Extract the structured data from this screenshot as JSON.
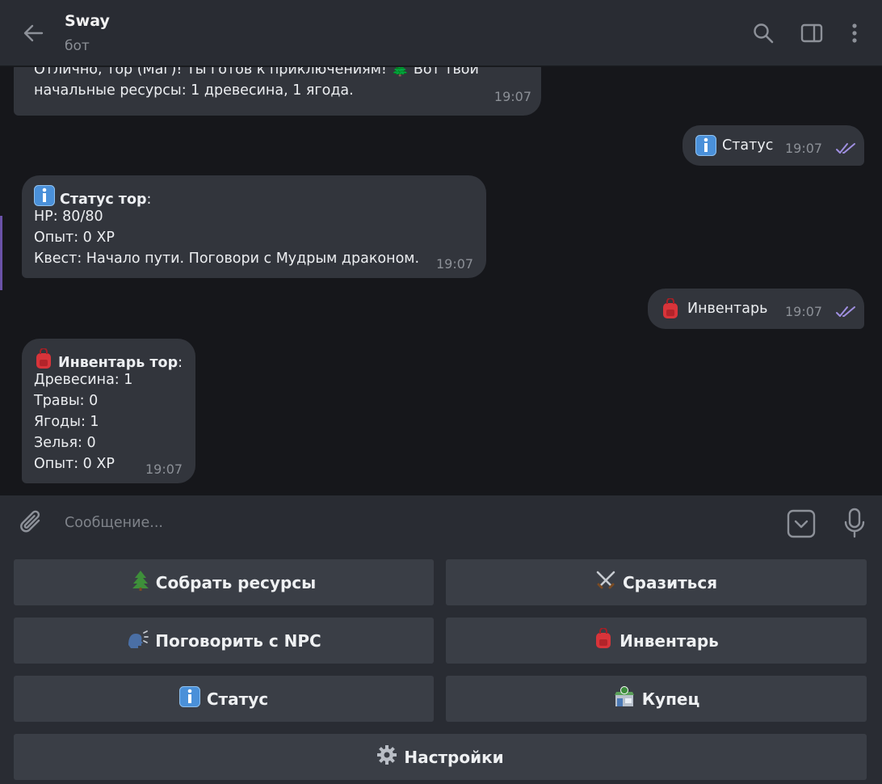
{
  "header": {
    "title": "Sway",
    "subtitle": "бот",
    "back_icon": "arrow-left-icon",
    "search_icon": "search-icon",
    "sidebar_icon": "sidebar-toggle-icon",
    "menu_icon": "more-vertical-icon"
  },
  "messages": [
    {
      "direction": "in",
      "lines": [
        "Отлично, тор (Маг)! Ты готов к приключениям! 🌲 Вот твои",
        "начальные ресурсы: 1 древесина, 1 ягода."
      ],
      "time": "19:07"
    },
    {
      "direction": "out",
      "emoji": "info-icon",
      "text": "Статус",
      "time": "19:07",
      "status": "read"
    },
    {
      "direction": "in",
      "heading": "Статус тор",
      "heading_suffix": ":",
      "lines": [
        "HP: 80/80",
        "Опыт: 0 XP",
        "Квест: Начало пути. Поговори с Мудрым драконом."
      ],
      "time": "19:07"
    },
    {
      "direction": "out",
      "emoji": "backpack-icon",
      "text": "Инвентарь",
      "time": "19:07",
      "status": "read"
    },
    {
      "direction": "in",
      "heading": "Инвентарь тор",
      "heading_suffix": ":",
      "lines": [
        "Древесина: 1",
        "Травы: 0",
        "Ягоды: 1",
        "Зелья: 0",
        "Опыт: 0 XP"
      ],
      "time": "19:07"
    }
  ],
  "composer": {
    "placeholder": "Сообщение...",
    "attach_icon": "paperclip-icon",
    "keyboard_icon": "keyboard-toggle-icon",
    "mic_icon": "microphone-icon"
  },
  "keyboard": [
    {
      "label": "Собрать ресурсы",
      "icon": "tree-icon"
    },
    {
      "label": "Сразиться",
      "icon": "crossed-swords-icon"
    },
    {
      "label": "Поговорить с NPC",
      "icon": "speaking-head-icon"
    },
    {
      "label": "Инвентарь",
      "icon": "backpack-icon"
    },
    {
      "label": "Статус",
      "icon": "info-icon"
    },
    {
      "label": "Купец",
      "icon": "shop-icon"
    },
    {
      "label": "Настройки",
      "icon": "gear-icon"
    }
  ],
  "colors": {
    "accent": "#8f7bd6",
    "bubble": "#32353c",
    "background": "#16171b",
    "header": "#292c33"
  }
}
